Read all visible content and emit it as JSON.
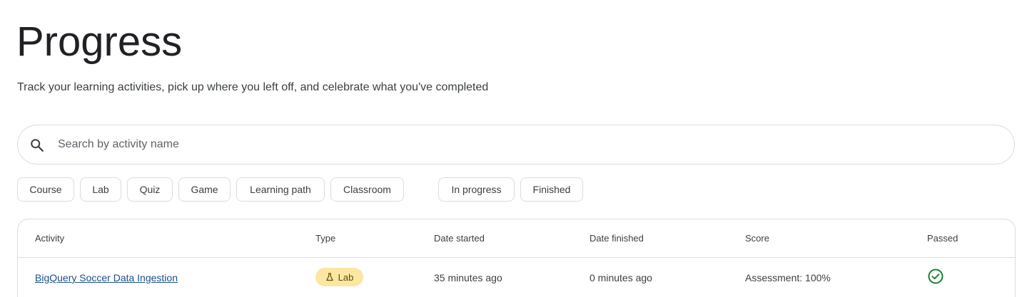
{
  "header": {
    "title": "Progress",
    "subtitle": "Track your learning activities, pick up where you left off, and celebrate what you've completed"
  },
  "search": {
    "placeholder": "Search by activity name",
    "value": ""
  },
  "filters": {
    "type_chips": [
      "Course",
      "Lab",
      "Quiz",
      "Game",
      "Learning path",
      "Classroom"
    ],
    "status_chips": [
      "In progress",
      "Finished"
    ]
  },
  "table": {
    "columns": [
      "Activity",
      "Type",
      "Date started",
      "Date finished",
      "Score",
      "Passed"
    ],
    "rows": [
      {
        "activity": "BigQuery Soccer Data Ingestion",
        "type": "Lab",
        "type_icon": "flask-icon",
        "date_started": "35 minutes ago",
        "date_finished": "0 minutes ago",
        "score": "Assessment: 100%",
        "passed_icon": "check-circle-icon"
      }
    ]
  },
  "colors": {
    "lab_badge_bg": "#fbe7a1",
    "passed_green": "#188038",
    "link": "#1a508b"
  }
}
